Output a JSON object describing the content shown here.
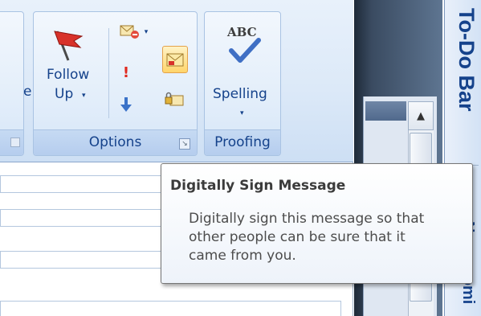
{
  "ribbon": {
    "partial_label": "e",
    "options": {
      "group_label": "Options",
      "follow_up_line1": "Follow",
      "follow_up_line2": "Up",
      "dropdown_arrow": "▾"
    },
    "proofing": {
      "group_label": "Proofing",
      "abc_label": "ABC",
      "spelling_label": "Spelling",
      "dropdown_arrow": "▾"
    }
  },
  "todo_bar": {
    "title": "To-Do Bar",
    "no_upcoming": "No upcomi"
  },
  "scroll": {
    "up_arrow": "▲"
  },
  "tooltip": {
    "title": "Digitally Sign Message",
    "line1": "Digitally sign this message so that",
    "line2": "other people can be sure that it",
    "line3": "came from you."
  },
  "colors": {
    "accent": "#15428b",
    "ribbon_bg": "#dce9f8",
    "highlight": "#ffd56b"
  }
}
